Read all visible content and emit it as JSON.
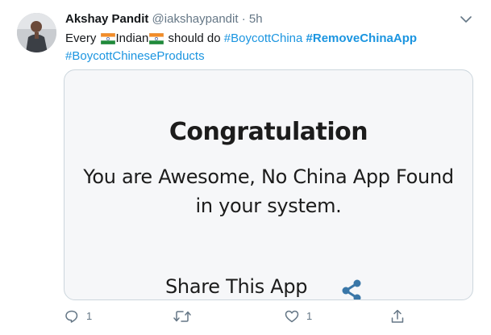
{
  "tweet": {
    "author_name": "Akshay Pandit",
    "handle": "@iakshaypandit",
    "separator": "·",
    "time": "5h",
    "text": {
      "part1": "Every ",
      "word_indian": "Indian",
      "part2": " should do ",
      "hashtag1": "#BoycottChina",
      "hashtag2": "#RemoveChinaApp",
      "hashtag3": "#BoycottChineseProducts"
    },
    "card": {
      "title": "Congratulation",
      "message_line1": "You are Awesome, No China App Found",
      "message_line2": "in your system.",
      "share_label": "Share This App"
    },
    "actions": {
      "reply_count": "1",
      "like_count": "1"
    }
  },
  "colors": {
    "link": "#1b95e0",
    "muted": "#657786",
    "text": "#14171a",
    "share_icon": "#3a77a8",
    "card_bg": "#f6f7f9"
  },
  "icons": {
    "caret": "chevron-down-icon",
    "reply": "reply-icon",
    "retweet": "retweet-icon",
    "like": "heart-icon",
    "share": "share-icon",
    "card_share": "share-network-icon",
    "flag": "india-flag-emoji"
  }
}
